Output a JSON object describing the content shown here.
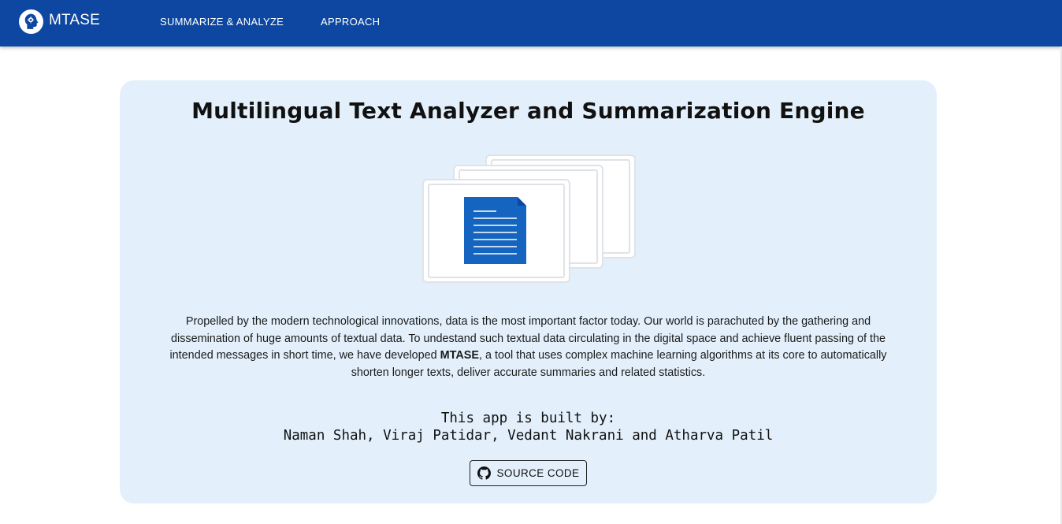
{
  "header": {
    "brand": "MTASE",
    "logo_icon": "head-gear-icon",
    "nav": [
      {
        "label": "SUMMARIZE & ANALYZE"
      },
      {
        "label": "APPROACH"
      }
    ],
    "bg_color": "#0d47a1"
  },
  "main": {
    "title": "Multilingual Text Analyzer and Summarization Engine",
    "illustration_icon": "stacked-documents-icon",
    "description": {
      "before": "Propelled by the modern technological innovations, data is the most important factor today. Our world is parachuted by the gathering and dissemination of huge amounts of textual data. To undestand such textual data circulating in the digital space and achieve fluent passing of the intended messages in short time, we have developed ",
      "bold": "MTASE",
      "after": ", a tool that uses complex machine learning algorithms at its core to automatically shorten longer texts, deliver accurate summaries and related statistics."
    },
    "built_by_label": "This app is built by:",
    "authors": "Naman Shah, Viraj Patidar, Vedant Nakrani and Atharva Patil",
    "source_button": {
      "label": "SOURCE CODE",
      "icon": "github-icon"
    },
    "card_bg": "#e3f0fb"
  }
}
